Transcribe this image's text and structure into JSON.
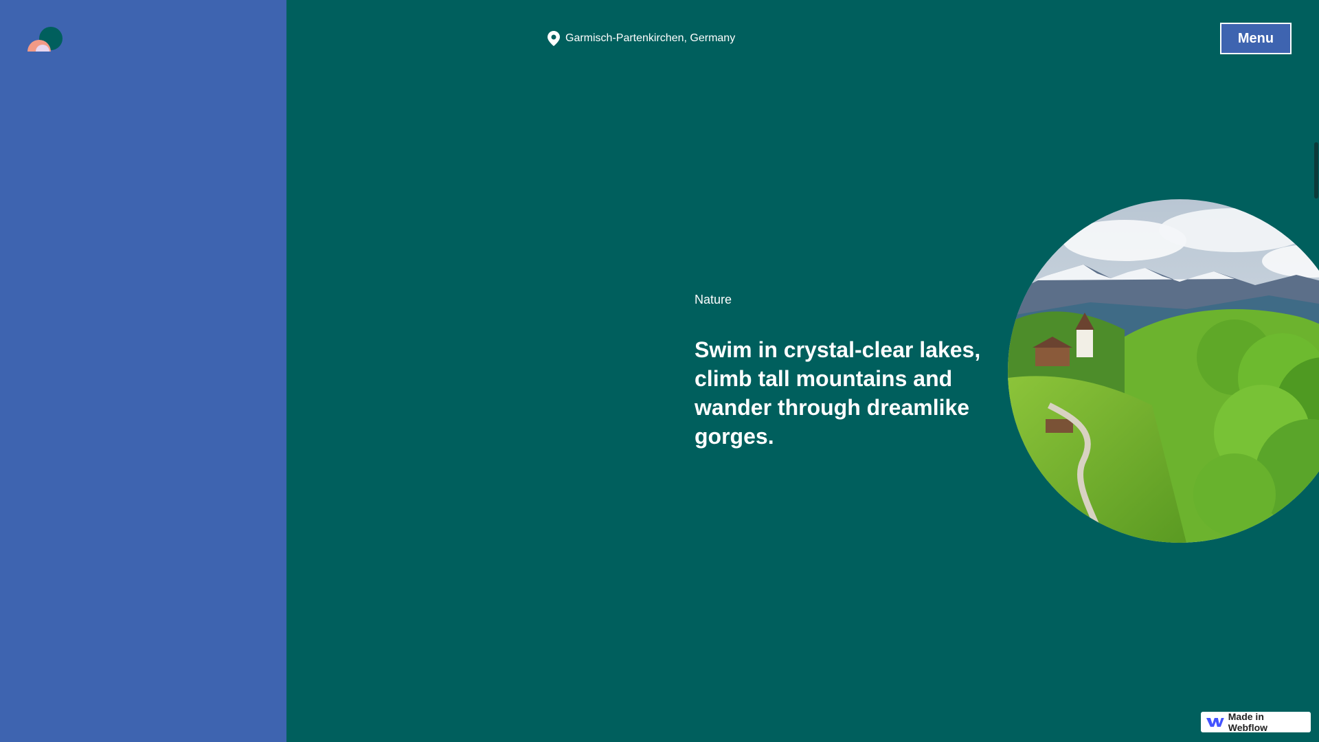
{
  "header": {
    "location_text": "Garmisch-Partenkirchen, Germany",
    "menu_label": "Menu"
  },
  "content": {
    "section_label": "Nature",
    "headline": "Swim in crystal-clear lakes, climb tall mountains and wander through dreamlike gorges."
  },
  "badge": {
    "label": "Made in Webflow"
  },
  "icons": {
    "logo": "logo-icon",
    "location": "map-pin-icon",
    "webflow": "webflow-icon"
  },
  "colors": {
    "left_panel": "#3e64b0",
    "main_bg": "#005f5d",
    "menu_button_bg": "#3e64b0",
    "text": "#ffffff"
  }
}
